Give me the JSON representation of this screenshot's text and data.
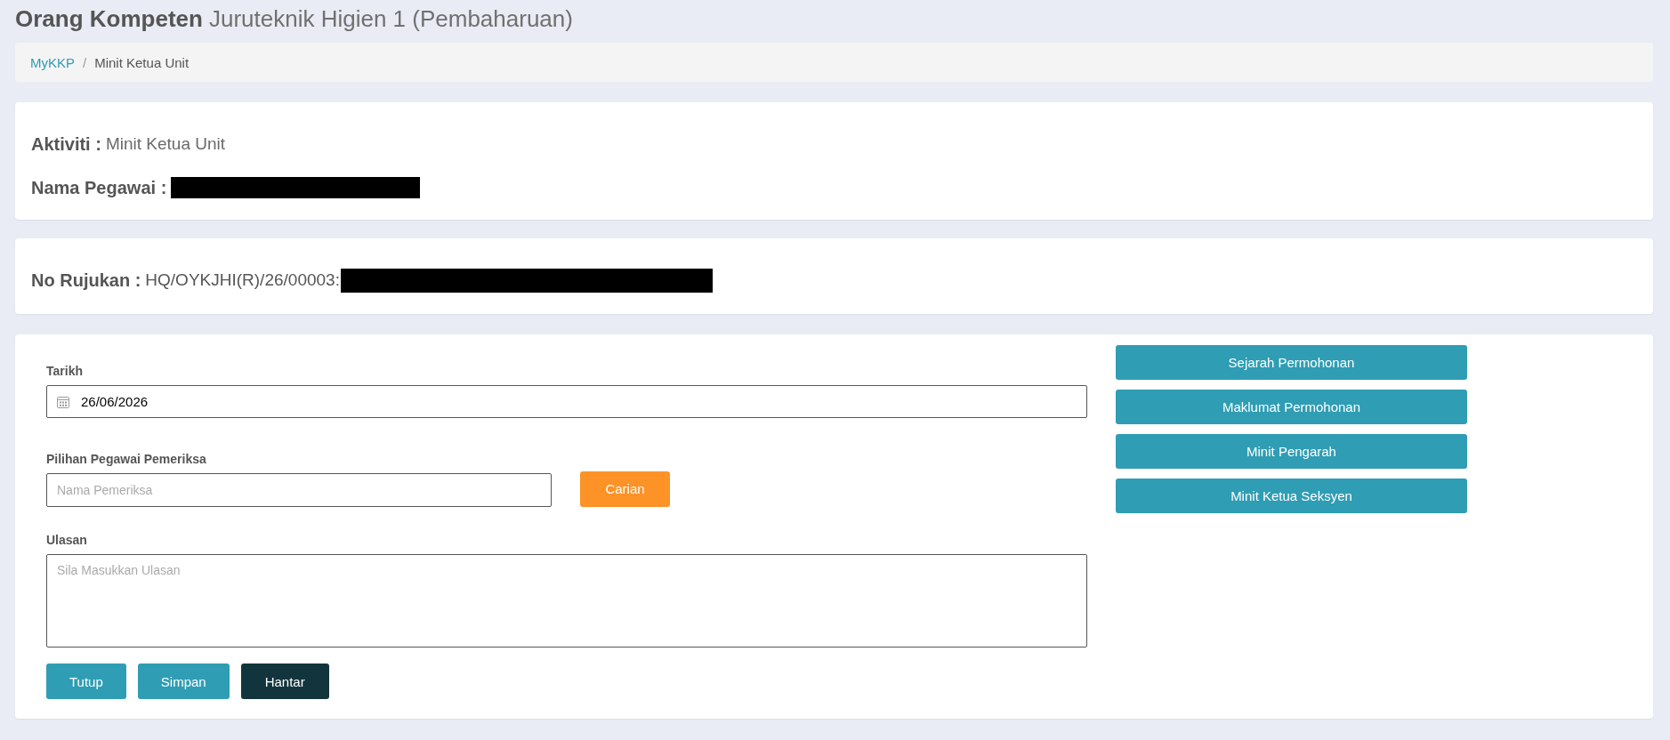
{
  "header": {
    "title": "Orang Kompeten",
    "subtitle": "Juruteknik Higien 1 (Pembaharuan)"
  },
  "breadcrumb": {
    "separator": "/",
    "items": [
      {
        "label": "MyKKP",
        "link": true
      },
      {
        "label": "Minit Ketua Unit",
        "link": false
      }
    ]
  },
  "info_card": {
    "fields": [
      {
        "label": "Aktiviti :",
        "value": "Minit Ketua Unit",
        "redacted": false
      },
      {
        "label": "Nama Pegawai :",
        "redacted": true
      }
    ]
  },
  "reference_card": {
    "label": "No Rujukan :",
    "value": "HQ/OYKJHI(R)/26/00003:",
    "redacted": true
  },
  "form": {
    "fields": [
      {
        "kind": "date",
        "label": "Tarikh",
        "value": "26/06/2026"
      },
      {
        "kind": "search",
        "label": "Pilihan Pegawai Pemeriksa",
        "placeholder": "Nama Pemeriksa",
        "button": "Carian"
      },
      {
        "kind": "textarea",
        "label": "Ulasan",
        "placeholder": "Sila Masukkan Ulasan"
      }
    ],
    "actions": [
      {
        "label": "Tutup",
        "kind": "default"
      },
      {
        "label": "Simpan",
        "kind": "default"
      },
      {
        "label": "Hantar",
        "kind": "primary"
      }
    ]
  },
  "side_buttons": [
    "Sejarah Permohonan",
    "Maklumat Permohonan",
    "Minit Pengarah",
    "Minit Ketua Seksyen"
  ]
}
